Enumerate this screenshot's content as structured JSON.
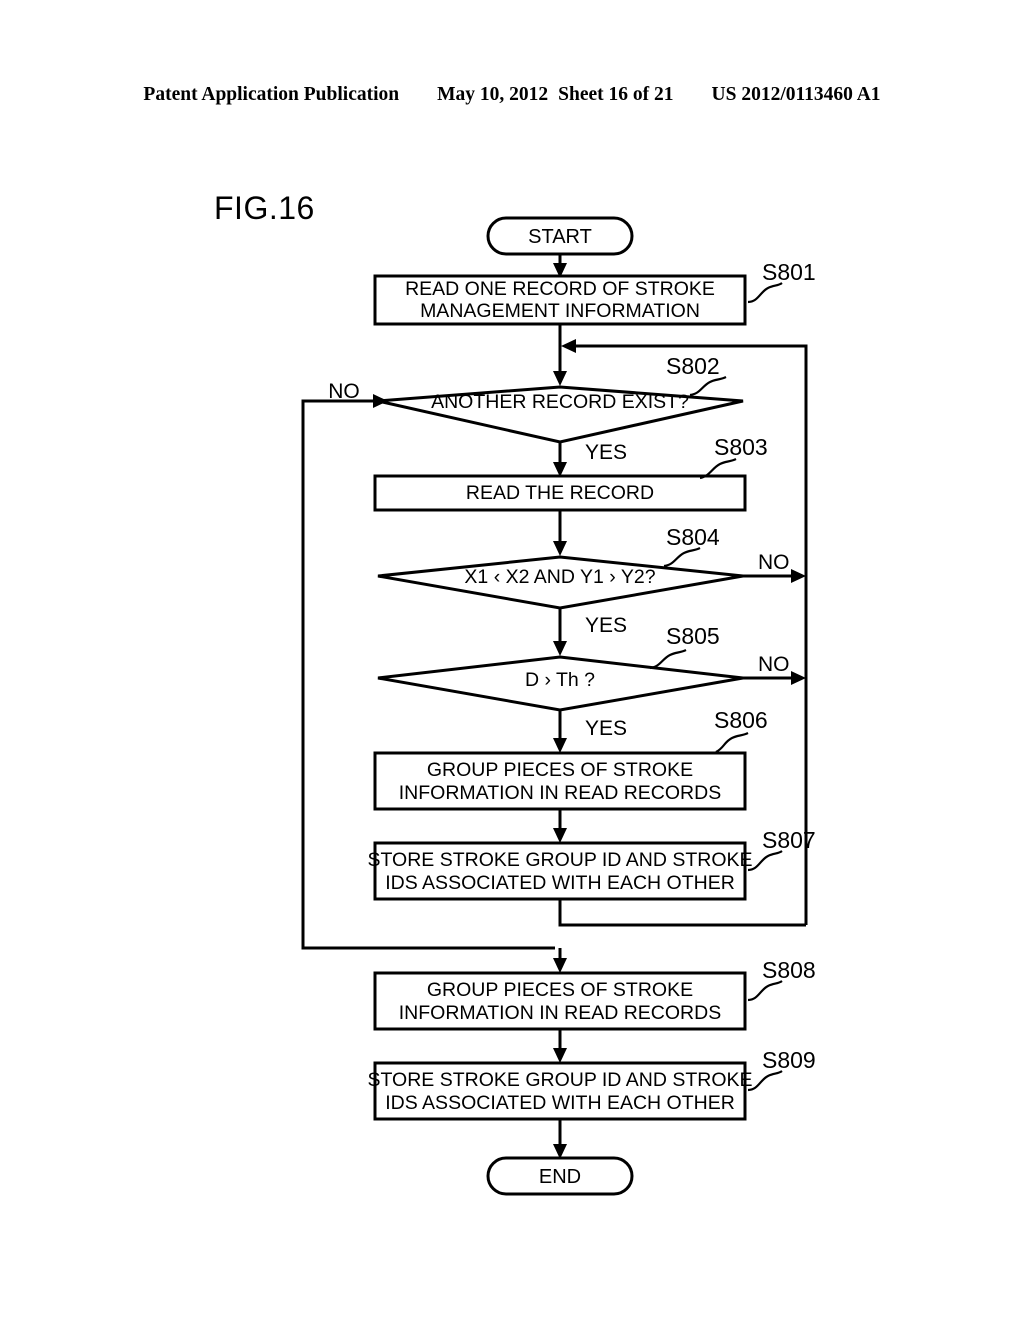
{
  "header": {
    "publication": "Patent Application Publication",
    "date": "May 10, 2012",
    "sheet": "Sheet 16 of 21",
    "patent_number": "US 2012/0113460 A1"
  },
  "figure": {
    "label": "FIG.16"
  },
  "flowchart": {
    "type": "flowchart",
    "terminators": {
      "start": "START",
      "end": "END"
    },
    "branch_labels": {
      "yes": "YES",
      "no": "NO"
    },
    "nodes": [
      {
        "id": "start",
        "kind": "terminator",
        "text": "START",
        "step": ""
      },
      {
        "id": "s801",
        "kind": "process",
        "step": "S801",
        "line1": "READ ONE RECORD OF STROKE",
        "line2": "MANAGEMENT INFORMATION"
      },
      {
        "id": "s802",
        "kind": "decision",
        "step": "S802",
        "line1": "ANOTHER RECORD EXIST?",
        "yes_label": "YES",
        "no_label": "NO"
      },
      {
        "id": "s803",
        "kind": "process",
        "step": "S803",
        "line1": "READ THE RECORD",
        "line2": ""
      },
      {
        "id": "s804",
        "kind": "decision",
        "step": "S804",
        "line1": "X1 ‹ X2 AND Y1 › Y2?",
        "yes_label": "YES",
        "no_label": "NO"
      },
      {
        "id": "s805",
        "kind": "decision",
        "step": "S805",
        "line1": "D › Th ?",
        "yes_label": "YES",
        "no_label": "NO"
      },
      {
        "id": "s806",
        "kind": "process",
        "step": "S806",
        "line1": "GROUP PIECES OF STROKE",
        "line2": "INFORMATION IN READ RECORDS"
      },
      {
        "id": "s807",
        "kind": "process",
        "step": "S807",
        "line1": "STORE STROKE GROUP ID AND STROKE",
        "line2": "IDS ASSOCIATED WITH EACH OTHER"
      },
      {
        "id": "s808",
        "kind": "process",
        "step": "S808",
        "line1": "GROUP PIECES OF STROKE",
        "line2": "INFORMATION IN READ RECORDS"
      },
      {
        "id": "s809",
        "kind": "process",
        "step": "S809",
        "line1": "STORE STROKE GROUP ID AND STROKE",
        "line2": "IDS ASSOCIATED WITH EACH OTHER"
      },
      {
        "id": "end",
        "kind": "terminator",
        "text": "END",
        "step": ""
      }
    ]
  },
  "colors": {
    "ink": "#000000",
    "paper": "#ffffff"
  }
}
